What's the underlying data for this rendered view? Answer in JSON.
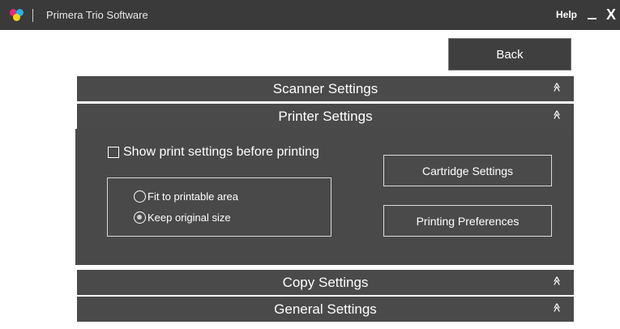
{
  "window": {
    "title": "Primera Trio Software",
    "help_label": "Help",
    "minimize_label": "_",
    "close_label": "X"
  },
  "back_button": {
    "label": "Back"
  },
  "sections": {
    "scanner": {
      "label": "Scanner Settings",
      "expanded": false
    },
    "printer": {
      "label": "Printer Settings",
      "expanded": true
    },
    "copy": {
      "label": "Copy Settings",
      "expanded": false
    },
    "general": {
      "label": "General Settings",
      "expanded": false
    }
  },
  "icons": {
    "collapsed": "«",
    "expanded": "»",
    "logo": "primera-logo-icon"
  },
  "printer_settings": {
    "show_before_printing": {
      "label": "Show print settings before printing",
      "checked": false
    },
    "scaling": {
      "options": [
        "Fit to printable area",
        "Keep original size"
      ],
      "selected": "Keep original size"
    },
    "cartridge_button": "Cartridge Settings",
    "preferences_button": "Printing Preferences"
  },
  "colors": {
    "titlebar": "#3a3a3a",
    "section": "#4a4a4a",
    "panel": "#494949",
    "logo_magenta": "#e8287c",
    "logo_cyan": "#1fb5e8",
    "logo_yellow": "#f4d21a"
  }
}
